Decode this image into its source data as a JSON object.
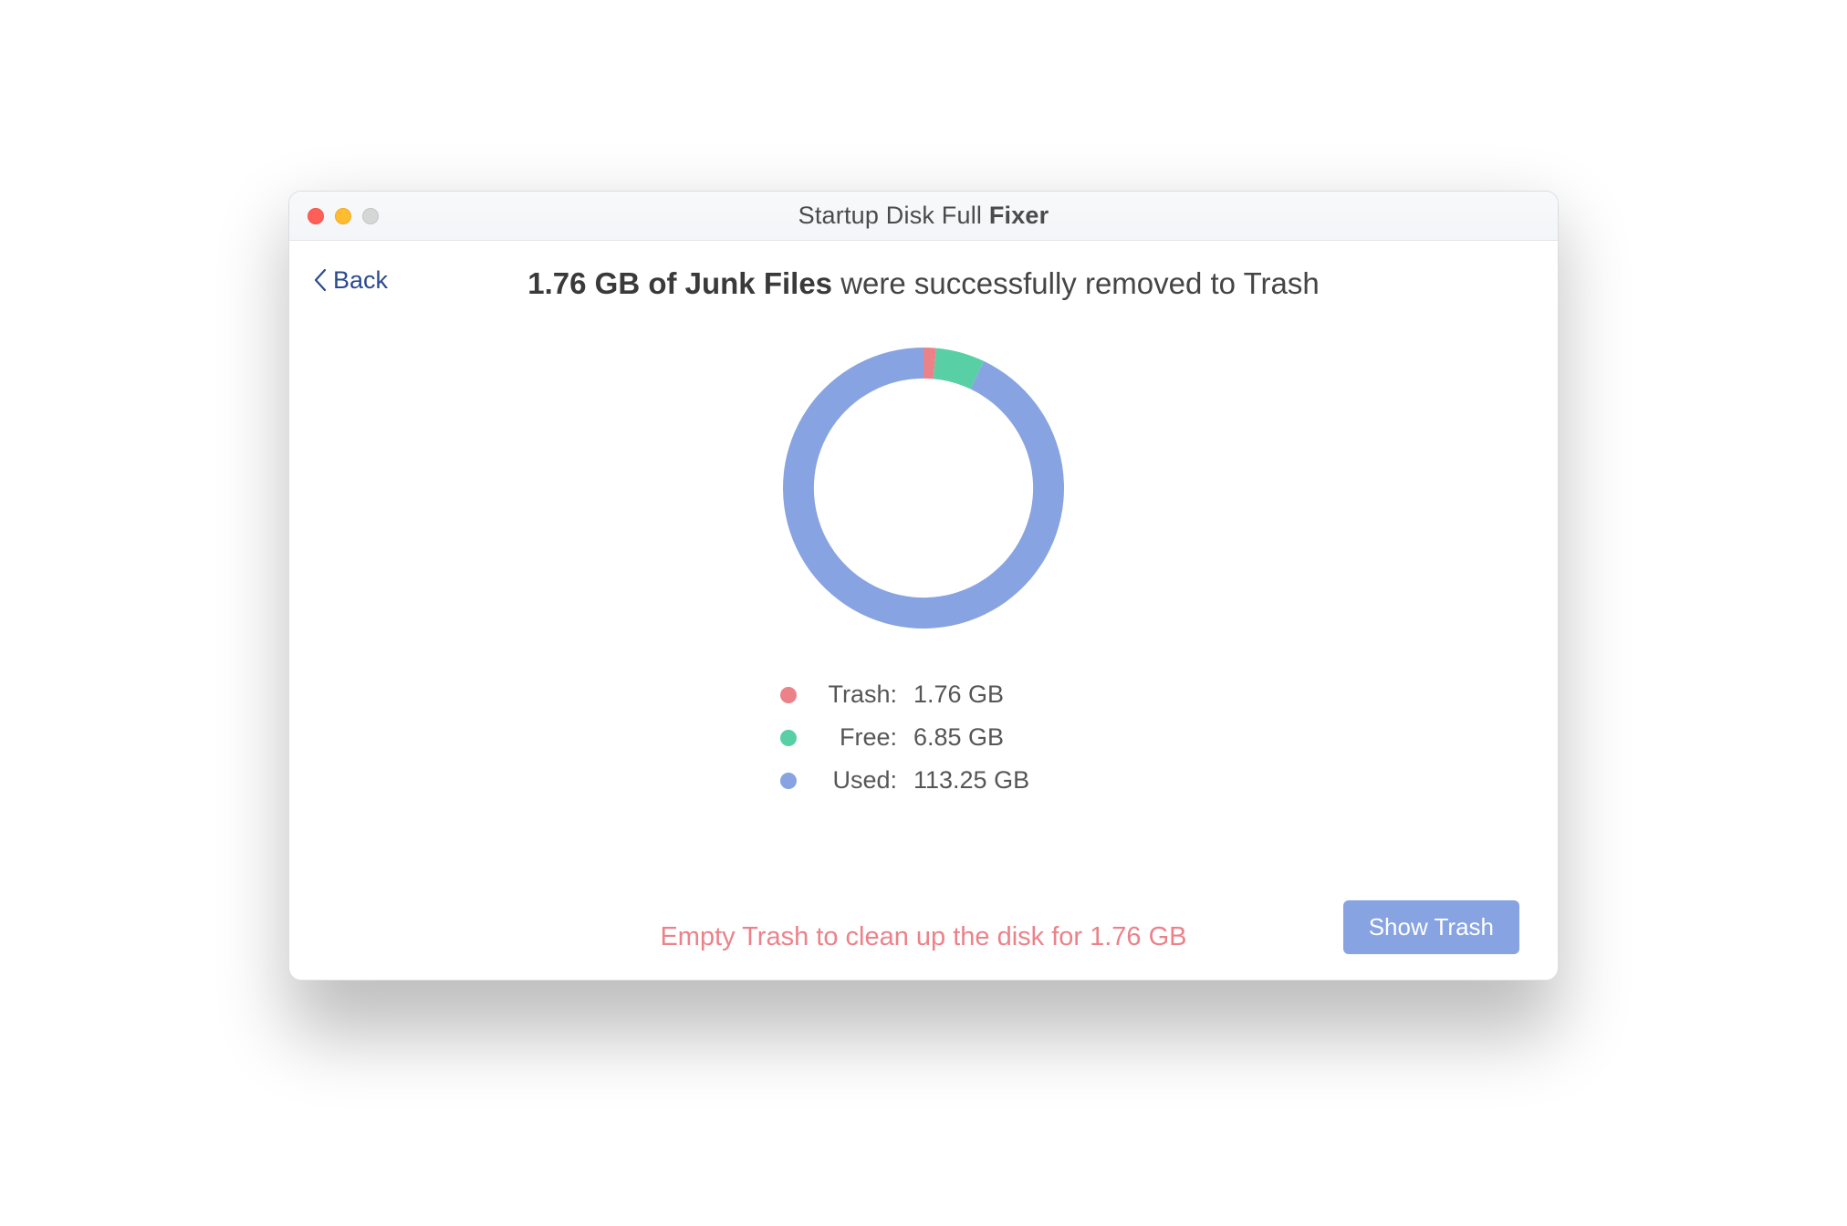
{
  "window": {
    "title_light": "Startup Disk Full",
    "title_bold": "Fixer"
  },
  "nav": {
    "back_label": "Back"
  },
  "heading": {
    "bold": "1.76 GB of Junk Files",
    "rest": " were successfully removed to Trash"
  },
  "legend": {
    "trash": {
      "label": "Trash:",
      "value": "1.76 GB",
      "color": "#ec8289"
    },
    "free": {
      "label": "Free:",
      "value": "6.85 GB",
      "color": "#59cfa5"
    },
    "used": {
      "label": "Used:",
      "value": "113.25 GB",
      "color": "#87a3e1"
    }
  },
  "footer": {
    "tip": "Empty Trash to clean up the disk for 1.76 GB",
    "button": "Show Trash"
  },
  "colors": {
    "trash": "#ec8289",
    "free": "#59cfa5",
    "used": "#87a3e1",
    "back_link": "#2c4a8f",
    "tip_text": "#ec8289"
  },
  "chart_data": {
    "type": "pie",
    "title": "",
    "series": [
      {
        "name": "Trash",
        "value": 1.76,
        "color": "#ec8289"
      },
      {
        "name": "Free",
        "value": 6.85,
        "color": "#59cfa5"
      },
      {
        "name": "Used",
        "value": 113.25,
        "color": "#87a3e1"
      }
    ],
    "unit": "GB",
    "donut": true,
    "inner_radius_ratio": 0.78,
    "start_angle_deg": -90
  }
}
